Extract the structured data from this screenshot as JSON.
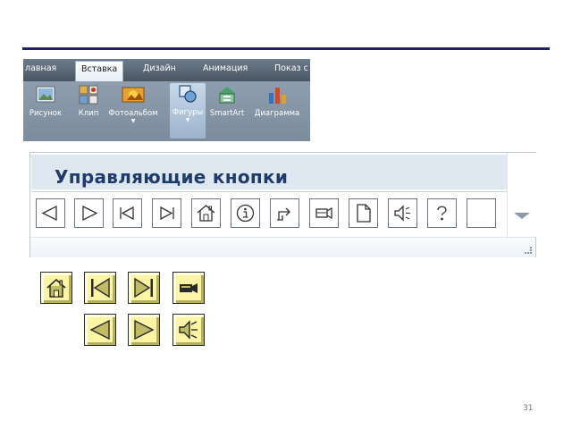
{
  "ribbon": {
    "tabs": [
      {
        "label": "лавная",
        "active": false
      },
      {
        "label": "Вставка",
        "active": true
      },
      {
        "label": "Дизайн",
        "active": false
      },
      {
        "label": "Анимация",
        "active": false
      },
      {
        "label": "Показ с",
        "active": false
      }
    ],
    "buttons": [
      {
        "label": "Рисунок",
        "icon": "picture-icon"
      },
      {
        "label": "Клип",
        "icon": "clipart-icon"
      },
      {
        "label": "Фотоальбом",
        "icon": "photo-album-icon",
        "dropdown": true
      },
      {
        "label": "Фигуры",
        "icon": "shapes-icon",
        "dropdown": true,
        "active": true
      },
      {
        "label": "SmartArt",
        "icon": "smartart-icon"
      },
      {
        "label": "Диаграмма",
        "icon": "chart-icon"
      }
    ]
  },
  "gallery": {
    "title": "Управляющие кнопки",
    "buttons": [
      "back-icon",
      "forward-icon",
      "beginning-icon",
      "end-icon",
      "home-icon",
      "information-icon",
      "return-icon",
      "movie-icon",
      "document-icon",
      "sound-icon",
      "help-icon",
      "custom-icon"
    ]
  },
  "yellow_buttons": {
    "row1": [
      "home-icon",
      "beginning-icon",
      "end-icon",
      "movie-icon"
    ],
    "row2": [
      "back-icon",
      "forward-icon",
      "sound-icon"
    ],
    "colors": {
      "face": "#fbf5a5",
      "highlight": "#fffde0",
      "shadow": "#b6b05a",
      "glyph": "#c0bb64"
    }
  },
  "slide": {
    "page_number": "31",
    "rule_color": "#1f1f6e"
  }
}
